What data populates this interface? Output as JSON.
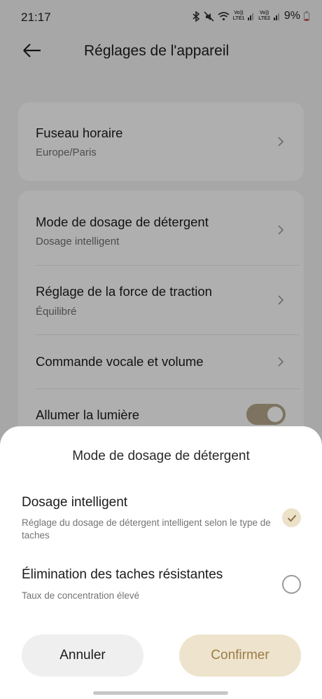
{
  "status_bar": {
    "time": "21:17",
    "battery": "9%",
    "sim1_top": "Vo))",
    "sim1_bottom": "LTE1",
    "sim2_top": "Vo))",
    "sim2_bottom": "LTE2",
    "icons": [
      "bluetooth-icon",
      "mute-icon",
      "wifi-icon",
      "signal-icon",
      "battery-icon"
    ]
  },
  "header": {
    "title": "Réglages de l'appareil",
    "back_icon": "back-arrow-icon"
  },
  "settings": {
    "timezone": {
      "label": "Fuseau horaire",
      "value": "Europe/Paris"
    },
    "items": [
      {
        "label": "Mode de dosage de détergent",
        "value": "Dosage intelligent"
      },
      {
        "label": "Réglage de la force de traction",
        "value": "Équilibré"
      },
      {
        "label": "Commande vocale et volume"
      },
      {
        "label": "Allumer la lumière",
        "toggle_on": true
      }
    ]
  },
  "sheet": {
    "title": "Mode de dosage de détergent",
    "options": [
      {
        "label": "Dosage intelligent",
        "description": "Réglage du dosage de détergent intelligent selon le type de taches",
        "selected": true
      },
      {
        "label": "Élimination des taches résistantes",
        "description": "Taux de concentration élevé",
        "selected": false
      }
    ],
    "cancel_label": "Annuler",
    "confirm_label": "Confirmer"
  },
  "colors": {
    "accent": "#b3a58a",
    "confirm_bg": "#eee3cc",
    "confirm_text": "#9a7d47"
  }
}
